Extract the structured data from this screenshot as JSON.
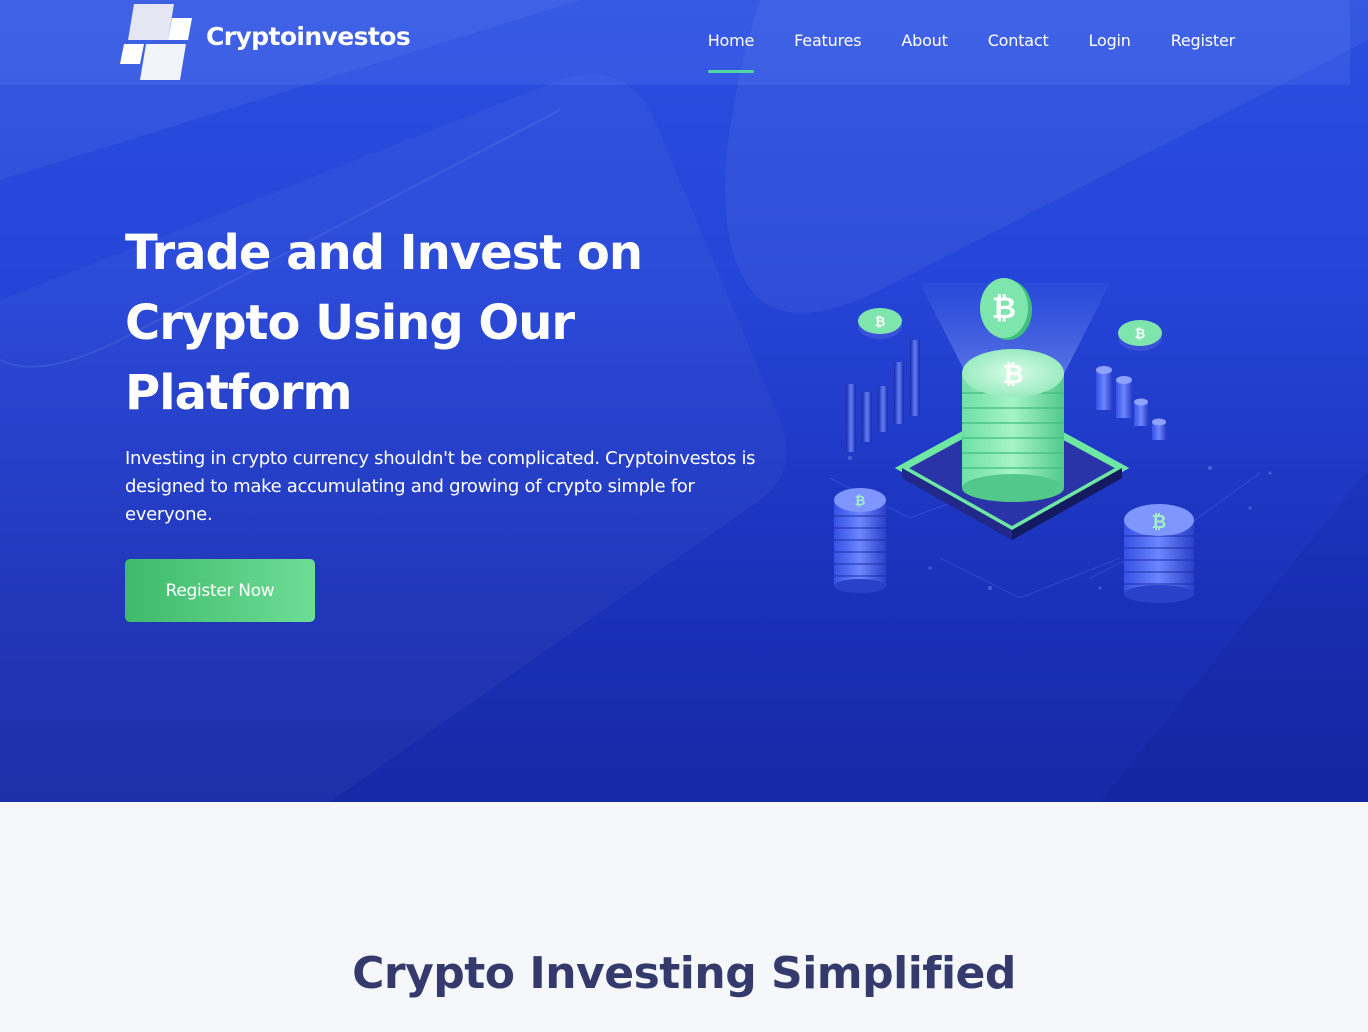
{
  "brand": {
    "name": "Cryptoinvestos"
  },
  "nav": {
    "items": [
      {
        "label": "Home",
        "active": true
      },
      {
        "label": "Features"
      },
      {
        "label": "About"
      },
      {
        "label": "Contact"
      },
      {
        "label": "Login"
      },
      {
        "label": "Register"
      }
    ]
  },
  "hero": {
    "title": "Trade and Invest on Crypto Using Our Platform",
    "description": "Investing in crypto currency shouldn't be complicated. Cryptoinvestos is designed to make accumulating and growing of crypto simple for everyone.",
    "cta_label": "Register Now"
  },
  "section": {
    "title": "Crypto Investing Simplified"
  },
  "colors": {
    "hero_bg": "#2545d8",
    "accent_green": "#4fd8a0",
    "cta_green": "#3fba6c",
    "heading_dark": "#343a6b",
    "page_bg": "#f5f7fb"
  },
  "icons": {
    "logo": "stacked-parallelograms-logo",
    "illustration": "isometric-crypto-coin-stack"
  }
}
